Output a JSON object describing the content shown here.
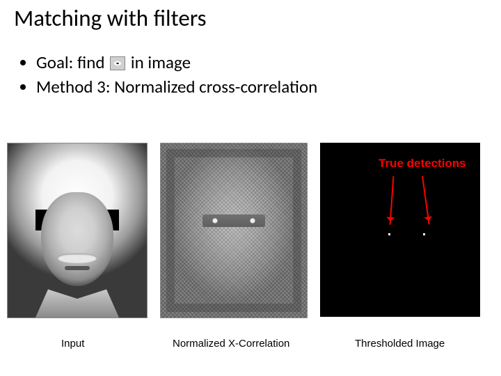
{
  "title": "Matching with filters",
  "bullet1_prefix": "Goal: find",
  "bullet1_suffix": "in image",
  "bullet2": "Method 3: Normalized cross-correlation",
  "detections_label": "True detections",
  "caption_input": "Input",
  "caption_ncc": "Normalized X-Correlation",
  "caption_thresh": "Thresholded Image"
}
